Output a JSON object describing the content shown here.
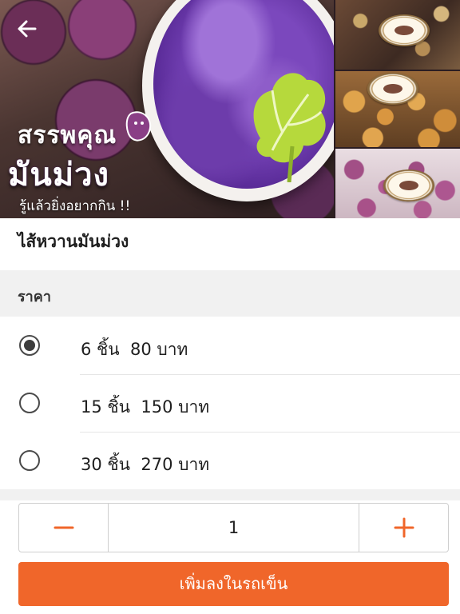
{
  "hero": {
    "promo_line1": "สรรพคุณ",
    "promo_line2": "มันม่วง",
    "promo_line3": "รู้แล้วยิ่งอยากกิน !!"
  },
  "icons": {
    "back": "arrow-left-icon",
    "radio_checked": "radio-checked-icon",
    "radio_unchecked": "radio-unchecked-icon",
    "minus": "minus-icon",
    "plus": "plus-icon"
  },
  "product": {
    "title": "ไส้หวานมันม่วง"
  },
  "price_group": {
    "label": "ราคา",
    "options": [
      {
        "label": "6 ชิ้น  80 บาท",
        "selected": true
      },
      {
        "label": "15 ชิ้น  150 บาท",
        "selected": false
      },
      {
        "label": "30 ชิ้น  270 บาท",
        "selected": false
      }
    ]
  },
  "quantity": {
    "value": "1"
  },
  "cart": {
    "add_label": "เพิ่มลงในรถเข็น"
  },
  "colors": {
    "accent": "#f0662a",
    "section_bg": "#f1f1f1",
    "radio": "#3d3d3d"
  }
}
